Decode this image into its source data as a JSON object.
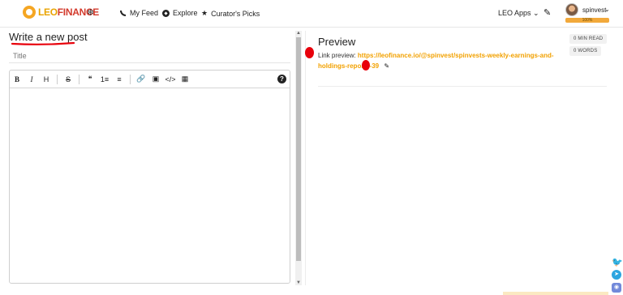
{
  "brand": {
    "leo": "LEO",
    "finance": "FINANCE",
    "theme_icon": "snowflake-icon"
  },
  "nav": {
    "feed": "My Feed",
    "explore": "Explore",
    "picks": "Curator's Picks",
    "apps": "LEO Apps"
  },
  "user": {
    "name": "spinvest",
    "vp": "100%"
  },
  "editor": {
    "heading": "Write a new post",
    "title_placeholder": "Title",
    "toolbar": [
      "B",
      "I",
      "H",
      "S",
      "❝",
      "1≡",
      "≡",
      "🔗",
      "▣",
      "</>",
      "▦"
    ],
    "help": "?"
  },
  "preview": {
    "title": "Preview",
    "min_read": "0 MIN READ",
    "words": "0 WORDS",
    "link_label": "Link preview:",
    "link_url": "https://leofinance.io/@spinvest/spinvests-weekly-earnings-and-holdings-reports-39"
  },
  "colors": {
    "accent": "#f2a100",
    "brand_red": "#d33a2c",
    "annotation_red": "#e8000b"
  }
}
